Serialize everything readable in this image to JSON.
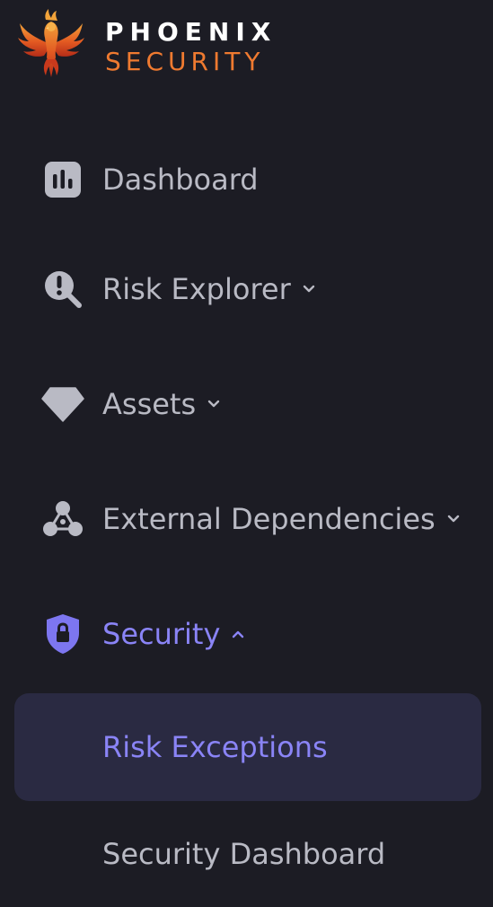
{
  "brand": {
    "name_line1": "PHOENIX",
    "name_line2": "SECURITY",
    "logo_icon": "phoenix-logo-icon",
    "color_line1": "#ffffff",
    "color_line2": "#ef7a30"
  },
  "colors": {
    "background": "#1c1c24",
    "text": "#b9bac4",
    "accent": "#8a84f6",
    "active_bg": "#2a2a42"
  },
  "nav": {
    "items": [
      {
        "label": "Dashboard",
        "icon": "bar-chart-icon",
        "expandable": false
      },
      {
        "label": "Risk Explorer",
        "icon": "magnify-alert-icon",
        "expandable": true,
        "expanded": false
      },
      {
        "label": "Assets",
        "icon": "diamond-icon",
        "expandable": true,
        "expanded": false
      },
      {
        "label": "External Dependencies",
        "icon": "molecule-icon",
        "expandable": true,
        "expanded": false
      },
      {
        "label": "Security",
        "icon": "shield-lock-icon",
        "expandable": true,
        "expanded": true,
        "active": true
      }
    ],
    "security_children": [
      {
        "label": "Risk Exceptions",
        "active": true
      },
      {
        "label": "Security Dashboard",
        "active": false
      }
    ]
  }
}
